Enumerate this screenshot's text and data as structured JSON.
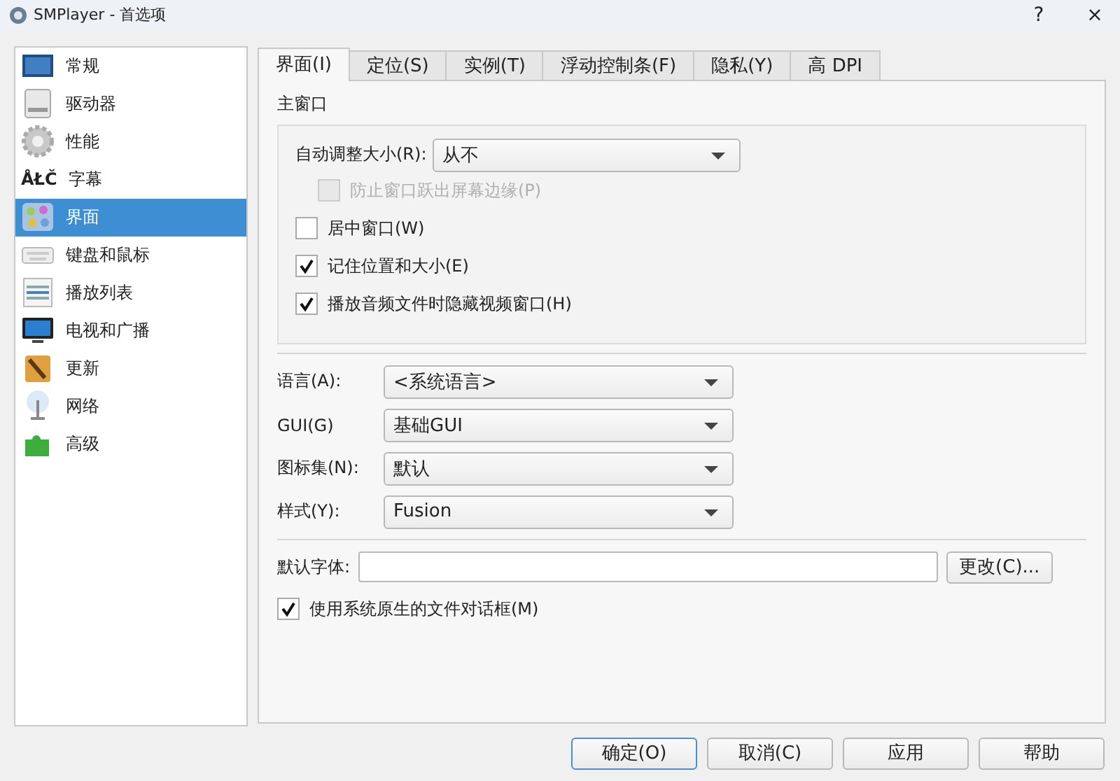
{
  "window": {
    "title": "SMPlayer - 首选项",
    "help": "?",
    "close": "×"
  },
  "sidebar": {
    "items": [
      {
        "label": "常规",
        "selected": false
      },
      {
        "label": "驱动器",
        "selected": false
      },
      {
        "label": "性能",
        "selected": false
      },
      {
        "label": "字幕",
        "selected": false,
        "glyph": "ÅŁČ"
      },
      {
        "label": "界面",
        "selected": true
      },
      {
        "label": "键盘和鼠标",
        "selected": false
      },
      {
        "label": "播放列表",
        "selected": false
      },
      {
        "label": "电视和广播",
        "selected": false
      },
      {
        "label": "更新",
        "selected": false
      },
      {
        "label": "网络",
        "selected": false
      },
      {
        "label": "高级",
        "selected": false
      }
    ]
  },
  "tabs": [
    {
      "label": "界面(I)",
      "selected": true
    },
    {
      "label": "定位(S)",
      "selected": false
    },
    {
      "label": "实例(T)",
      "selected": false
    },
    {
      "label": "浮动控制条(F)",
      "selected": false
    },
    {
      "label": "隐私(Y)",
      "selected": false
    },
    {
      "label": "高 DPI",
      "selected": false
    }
  ],
  "main_window": {
    "title": "主窗口",
    "resize": {
      "label": "自动调整大小(R):",
      "value": "从不",
      "sub_option": {
        "label": "防止窗口跃出屏幕边缘(P)",
        "checked": false,
        "disabled": true
      }
    },
    "checkboxes": [
      {
        "label": "居中窗口(W)",
        "checked": false,
        "disabled": false
      },
      {
        "label": "记住位置和大小(E)",
        "checked": true,
        "disabled": false
      },
      {
        "label": "播放音频文件时隐藏视频窗口(H)",
        "checked": true,
        "disabled": false
      }
    ]
  },
  "selectors": [
    {
      "label": "语言(A):",
      "value": "<系统语言>"
    },
    {
      "label": "GUI(G)",
      "value": "基础GUI"
    },
    {
      "label": "图标集(N):",
      "value": "默认"
    },
    {
      "label": "样式(Y):",
      "value": "Fusion"
    }
  ],
  "font": {
    "label": "默认字体:",
    "button": "更改(C)..."
  },
  "native_dialog": {
    "label": "使用系统原生的文件对话框(M)",
    "checked": true,
    "disabled": false
  },
  "buttons": [
    {
      "label": "确定(O)",
      "default": true
    },
    {
      "label": "取消(C)",
      "default": false
    },
    {
      "label": "应用",
      "default": false
    },
    {
      "label": "帮助",
      "default": false
    }
  ]
}
